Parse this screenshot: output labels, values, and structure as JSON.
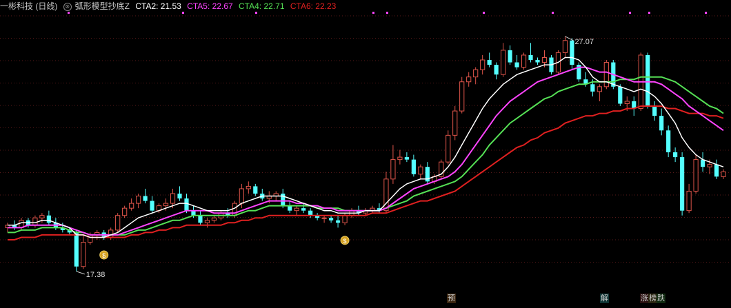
{
  "header": {
    "stock_title": "一彬科技 (日线)",
    "indicator_name": "弧形模型抄底Z",
    "cta2": "CTA2: 21.53",
    "cta5": "CTA5: 22.67",
    "cta4": "CTA4: 22.71",
    "cta6": "CTA6: 22.23"
  },
  "colors": {
    "background": "#000000",
    "up_candle": "#e0554a",
    "down_candle": "#54ffff",
    "cta2_line": "#ffffff",
    "cta5_line": "#ff44ff",
    "cta4_line": "#55e055",
    "cta6_line": "#e02020",
    "grid": "#5a1a1a"
  },
  "annotations": {
    "high_label": "27.07",
    "low_label": "17.38"
  },
  "bottom_badges": [
    {
      "label": "预",
      "color": "#e08030"
    },
    {
      "label": "解",
      "color": "#40c0c0"
    },
    {
      "label": "涨",
      "color": "#e04040"
    },
    {
      "label": "榜",
      "color": "#e0c040"
    },
    {
      "label": "跌",
      "color": "#40e040"
    }
  ],
  "chart_data": {
    "type": "candlestick",
    "ylim": [
      16.8,
      28.0
    ],
    "grid": true,
    "candles": [
      [
        19.2,
        19.4,
        19.0,
        19.3
      ],
      [
        19.3,
        19.5,
        19.1,
        19.2
      ],
      [
        19.2,
        19.6,
        19.1,
        19.5
      ],
      [
        19.5,
        19.6,
        19.2,
        19.3
      ],
      [
        19.3,
        19.7,
        19.2,
        19.6
      ],
      [
        19.6,
        19.8,
        19.4,
        19.7
      ],
      [
        19.7,
        19.9,
        19.3,
        19.4
      ],
      [
        19.4,
        19.6,
        19.1,
        19.2
      ],
      [
        19.2,
        19.4,
        19.0,
        19.1
      ],
      [
        19.1,
        19.2,
        18.9,
        19.0
      ],
      [
        19.0,
        19.1,
        17.4,
        17.6
      ],
      [
        17.6,
        18.9,
        17.5,
        18.6
      ],
      [
        18.6,
        19.0,
        18.5,
        18.9
      ],
      [
        18.9,
        19.1,
        18.7,
        19.0
      ],
      [
        19.0,
        19.1,
        18.7,
        18.8
      ],
      [
        18.8,
        19.2,
        18.7,
        19.1
      ],
      [
        19.1,
        19.8,
        19.0,
        19.7
      ],
      [
        19.7,
        20.1,
        19.6,
        20.0
      ],
      [
        20.0,
        20.4,
        19.9,
        20.2
      ],
      [
        20.2,
        20.6,
        20.0,
        20.5
      ],
      [
        20.5,
        20.8,
        20.2,
        20.3
      ],
      [
        20.3,
        20.5,
        19.8,
        19.9
      ],
      [
        19.9,
        20.2,
        19.8,
        20.1
      ],
      [
        20.1,
        20.4,
        19.9,
        20.2
      ],
      [
        20.2,
        20.8,
        20.0,
        20.6
      ],
      [
        20.6,
        20.9,
        20.3,
        20.4
      ],
      [
        20.4,
        20.6,
        19.8,
        19.9
      ],
      [
        19.9,
        20.1,
        19.6,
        19.7
      ],
      [
        19.7,
        19.9,
        19.3,
        19.4
      ],
      [
        19.4,
        19.6,
        19.2,
        19.5
      ],
      [
        19.5,
        19.7,
        19.4,
        19.6
      ],
      [
        19.6,
        19.9,
        19.5,
        19.8
      ],
      [
        19.8,
        20.0,
        19.6,
        19.7
      ],
      [
        19.7,
        20.3,
        19.6,
        20.2
      ],
      [
        20.2,
        21.0,
        20.0,
        20.8
      ],
      [
        20.8,
        21.1,
        20.6,
        20.9
      ],
      [
        20.9,
        21.0,
        20.5,
        20.6
      ],
      [
        20.6,
        20.8,
        20.3,
        20.4
      ],
      [
        20.4,
        20.7,
        20.2,
        20.5
      ],
      [
        20.5,
        20.7,
        20.3,
        20.6
      ],
      [
        20.6,
        20.8,
        20.0,
        20.1
      ],
      [
        20.1,
        20.3,
        19.8,
        19.9
      ],
      [
        19.9,
        20.1,
        19.7,
        20.0
      ],
      [
        20.0,
        20.2,
        19.8,
        19.9
      ],
      [
        19.9,
        20.0,
        19.6,
        19.7
      ],
      [
        19.7,
        19.8,
        19.5,
        19.6
      ],
      [
        19.6,
        19.7,
        19.4,
        19.6
      ],
      [
        19.6,
        19.7,
        19.4,
        19.5
      ],
      [
        19.5,
        19.7,
        19.2,
        19.4
      ],
      [
        19.4,
        19.8,
        19.3,
        19.7
      ],
      [
        19.7,
        20.0,
        19.6,
        19.9
      ],
      [
        19.9,
        20.1,
        19.7,
        19.8
      ],
      [
        19.8,
        20.0,
        19.7,
        19.9
      ],
      [
        19.9,
        20.1,
        19.8,
        20.0
      ],
      [
        20.0,
        20.2,
        19.8,
        19.9
      ],
      [
        19.9,
        21.5,
        19.8,
        21.2
      ],
      [
        21.2,
        22.6,
        21.0,
        22.0
      ],
      [
        22.0,
        22.4,
        21.8,
        22.1
      ],
      [
        22.1,
        22.3,
        21.9,
        22.0
      ],
      [
        22.0,
        22.2,
        21.3,
        21.4
      ],
      [
        21.4,
        21.8,
        21.2,
        21.7
      ],
      [
        21.7,
        21.9,
        21.0,
        21.1
      ],
      [
        21.1,
        21.4,
        21.0,
        21.3
      ],
      [
        21.3,
        22.0,
        21.2,
        21.9
      ],
      [
        21.9,
        23.2,
        21.8,
        23.0
      ],
      [
        23.0,
        24.2,
        22.8,
        24.0
      ],
      [
        24.0,
        25.4,
        23.9,
        25.2
      ],
      [
        25.2,
        25.6,
        25.0,
        25.4
      ],
      [
        25.4,
        25.8,
        25.1,
        25.7
      ],
      [
        25.7,
        26.3,
        25.5,
        26.1
      ],
      [
        26.1,
        26.4,
        25.8,
        25.9
      ],
      [
        25.9,
        26.0,
        25.3,
        25.5
      ],
      [
        25.5,
        26.8,
        25.4,
        26.5
      ],
      [
        26.5,
        26.7,
        25.9,
        26.0
      ],
      [
        26.0,
        26.3,
        25.7,
        25.8
      ],
      [
        25.8,
        26.4,
        25.7,
        26.3
      ],
      [
        26.3,
        26.8,
        26.0,
        26.1
      ],
      [
        26.1,
        26.2,
        25.9,
        26.0
      ],
      [
        26.0,
        26.5,
        25.8,
        26.2
      ],
      [
        26.2,
        26.3,
        25.5,
        25.6
      ],
      [
        25.6,
        26.5,
        25.5,
        26.4
      ],
      [
        26.4,
        27.07,
        26.2,
        26.9
      ],
      [
        26.9,
        27.0,
        25.7,
        25.9
      ],
      [
        25.9,
        26.0,
        25.2,
        25.3
      ],
      [
        25.3,
        25.6,
        25.0,
        25.1
      ],
      [
        25.1,
        25.3,
        24.6,
        24.8
      ],
      [
        24.8,
        25.1,
        24.4,
        25.0
      ],
      [
        25.0,
        26.1,
        24.9,
        26.0
      ],
      [
        26.0,
        26.1,
        24.9,
        25.0
      ],
      [
        25.0,
        25.1,
        24.2,
        24.3
      ],
      [
        24.3,
        24.6,
        24.0,
        24.4
      ],
      [
        24.4,
        24.6,
        23.8,
        24.1
      ],
      [
        24.1,
        26.4,
        24.0,
        26.3
      ],
      [
        26.3,
        26.4,
        24.1,
        24.2
      ],
      [
        24.2,
        24.4,
        23.6,
        23.8
      ],
      [
        23.8,
        24.1,
        23.0,
        23.2
      ],
      [
        23.2,
        23.4,
        22.1,
        22.3
      ],
      [
        22.3,
        22.5,
        21.9,
        22.1
      ],
      [
        22.1,
        22.3,
        19.7,
        19.9
      ],
      [
        19.9,
        21.0,
        19.8,
        20.7
      ],
      [
        20.7,
        22.2,
        20.6,
        22.0
      ],
      [
        22.0,
        22.3,
        21.5,
        21.7
      ],
      [
        21.7,
        22.0,
        21.4,
        21.8
      ],
      [
        21.8,
        22.0,
        21.2,
        21.3
      ],
      [
        21.3,
        21.6,
        21.2,
        21.5
      ]
    ],
    "series": [
      {
        "name": "CTA2",
        "values": [
          19.3,
          19.3,
          19.4,
          19.4,
          19.4,
          19.5,
          19.5,
          19.4,
          19.3,
          19.2,
          18.9,
          18.9,
          18.8,
          18.8,
          18.8,
          18.9,
          19.0,
          19.2,
          19.4,
          19.6,
          19.7,
          19.8,
          19.9,
          20.0,
          20.1,
          20.2,
          20.2,
          20.1,
          20.0,
          19.9,
          19.9,
          19.9,
          19.9,
          20.0,
          20.2,
          20.3,
          20.4,
          20.5,
          20.5,
          20.5,
          20.5,
          20.4,
          20.3,
          20.2,
          20.1,
          20.0,
          19.9,
          19.9,
          19.8,
          19.8,
          19.8,
          19.8,
          19.9,
          19.9,
          19.9,
          20.2,
          20.5,
          20.8,
          21.0,
          21.1,
          21.2,
          21.2,
          21.3,
          21.4,
          21.7,
          22.1,
          22.6,
          23.1,
          23.6,
          24.1,
          24.5,
          24.8,
          25.1,
          25.3,
          25.5,
          25.6,
          25.7,
          25.8,
          25.9,
          25.9,
          26.0,
          26.2,
          26.2,
          26.1,
          25.8,
          25.4,
          25.2,
          25.2,
          25.1,
          25.0,
          24.9,
          24.8,
          24.9,
          24.8,
          24.6,
          24.3,
          23.9,
          23.5,
          22.9,
          22.5,
          22.2,
          22.0,
          21.9,
          21.8,
          21.7
        ]
      },
      {
        "name": "CTA5",
        "values": [
          19.2,
          19.2,
          19.2,
          19.3,
          19.3,
          19.3,
          19.3,
          19.3,
          19.3,
          19.2,
          19.1,
          19.0,
          18.9,
          18.9,
          18.9,
          18.9,
          18.9,
          19.0,
          19.1,
          19.2,
          19.3,
          19.4,
          19.5,
          19.6,
          19.7,
          19.8,
          19.9,
          19.9,
          19.9,
          19.9,
          19.8,
          19.8,
          19.8,
          19.8,
          19.9,
          20.0,
          20.1,
          20.2,
          20.3,
          20.3,
          20.3,
          20.3,
          20.2,
          20.2,
          20.1,
          20.1,
          20.0,
          20.0,
          19.9,
          19.9,
          19.9,
          19.9,
          19.9,
          19.9,
          19.9,
          20.0,
          20.2,
          20.4,
          20.6,
          20.8,
          20.9,
          21.0,
          21.1,
          21.2,
          21.3,
          21.5,
          21.8,
          22.2,
          22.6,
          23.0,
          23.4,
          23.8,
          24.1,
          24.4,
          24.6,
          24.8,
          25.0,
          25.2,
          25.3,
          25.4,
          25.5,
          25.6,
          25.7,
          25.8,
          25.8,
          25.7,
          25.6,
          25.6,
          25.5,
          25.4,
          25.3,
          25.2,
          25.2,
          25.2,
          25.2,
          25.1,
          24.9,
          24.7,
          24.5,
          24.2,
          24.0,
          23.8,
          23.6,
          23.4,
          23.2
        ]
      },
      {
        "name": "CTA4",
        "values": [
          19.0,
          19.0,
          19.1,
          19.1,
          19.1,
          19.2,
          19.2,
          19.2,
          19.2,
          19.1,
          19.0,
          19.0,
          18.9,
          18.9,
          18.9,
          18.9,
          18.9,
          18.9,
          19.0,
          19.1,
          19.1,
          19.2,
          19.3,
          19.4,
          19.5,
          19.5,
          19.6,
          19.7,
          19.7,
          19.7,
          19.7,
          19.7,
          19.7,
          19.7,
          19.8,
          19.9,
          19.9,
          20.0,
          20.1,
          20.1,
          20.1,
          20.1,
          20.1,
          20.1,
          20.1,
          20.0,
          20.0,
          20.0,
          20.0,
          19.9,
          19.9,
          19.9,
          19.9,
          19.9,
          19.9,
          20.0,
          20.1,
          20.2,
          20.3,
          20.5,
          20.6,
          20.7,
          20.8,
          20.9,
          21.0,
          21.1,
          21.3,
          21.6,
          21.9,
          22.2,
          22.6,
          22.9,
          23.2,
          23.5,
          23.7,
          23.9,
          24.1,
          24.3,
          24.5,
          24.6,
          24.8,
          24.9,
          25.0,
          25.1,
          25.1,
          25.2,
          25.2,
          25.2,
          25.2,
          25.3,
          25.3,
          25.3,
          25.4,
          25.4,
          25.4,
          25.4,
          25.3,
          25.2,
          25.0,
          24.8,
          24.6,
          24.4,
          24.2,
          24.1,
          23.9
        ]
      },
      {
        "name": "CTA6",
        "values": [
          18.7,
          18.7,
          18.8,
          18.8,
          18.8,
          18.9,
          18.9,
          18.9,
          18.9,
          18.9,
          18.9,
          18.9,
          18.8,
          18.8,
          18.8,
          18.8,
          18.8,
          18.8,
          18.9,
          18.9,
          19.0,
          19.0,
          19.1,
          19.1,
          19.2,
          19.2,
          19.3,
          19.3,
          19.3,
          19.3,
          19.3,
          19.3,
          19.4,
          19.4,
          19.5,
          19.5,
          19.6,
          19.6,
          19.7,
          19.7,
          19.7,
          19.7,
          19.7,
          19.7,
          19.7,
          19.7,
          19.7,
          19.7,
          19.7,
          19.7,
          19.7,
          19.7,
          19.7,
          19.8,
          19.8,
          19.8,
          19.9,
          20.0,
          20.1,
          20.2,
          20.3,
          20.3,
          20.4,
          20.5,
          20.6,
          20.7,
          20.9,
          21.1,
          21.3,
          21.5,
          21.7,
          21.9,
          22.1,
          22.3,
          22.5,
          22.6,
          22.8,
          22.9,
          23.1,
          23.2,
          23.3,
          23.5,
          23.6,
          23.7,
          23.8,
          23.8,
          23.9,
          23.9,
          24.0,
          24.0,
          24.1,
          24.1,
          24.2,
          24.2,
          24.2,
          24.2,
          24.1,
          24.1,
          24.0,
          23.9,
          23.9,
          23.9,
          23.8,
          23.8,
          23.7
        ]
      }
    ],
    "signal_markers": [
      14,
      49
    ]
  }
}
